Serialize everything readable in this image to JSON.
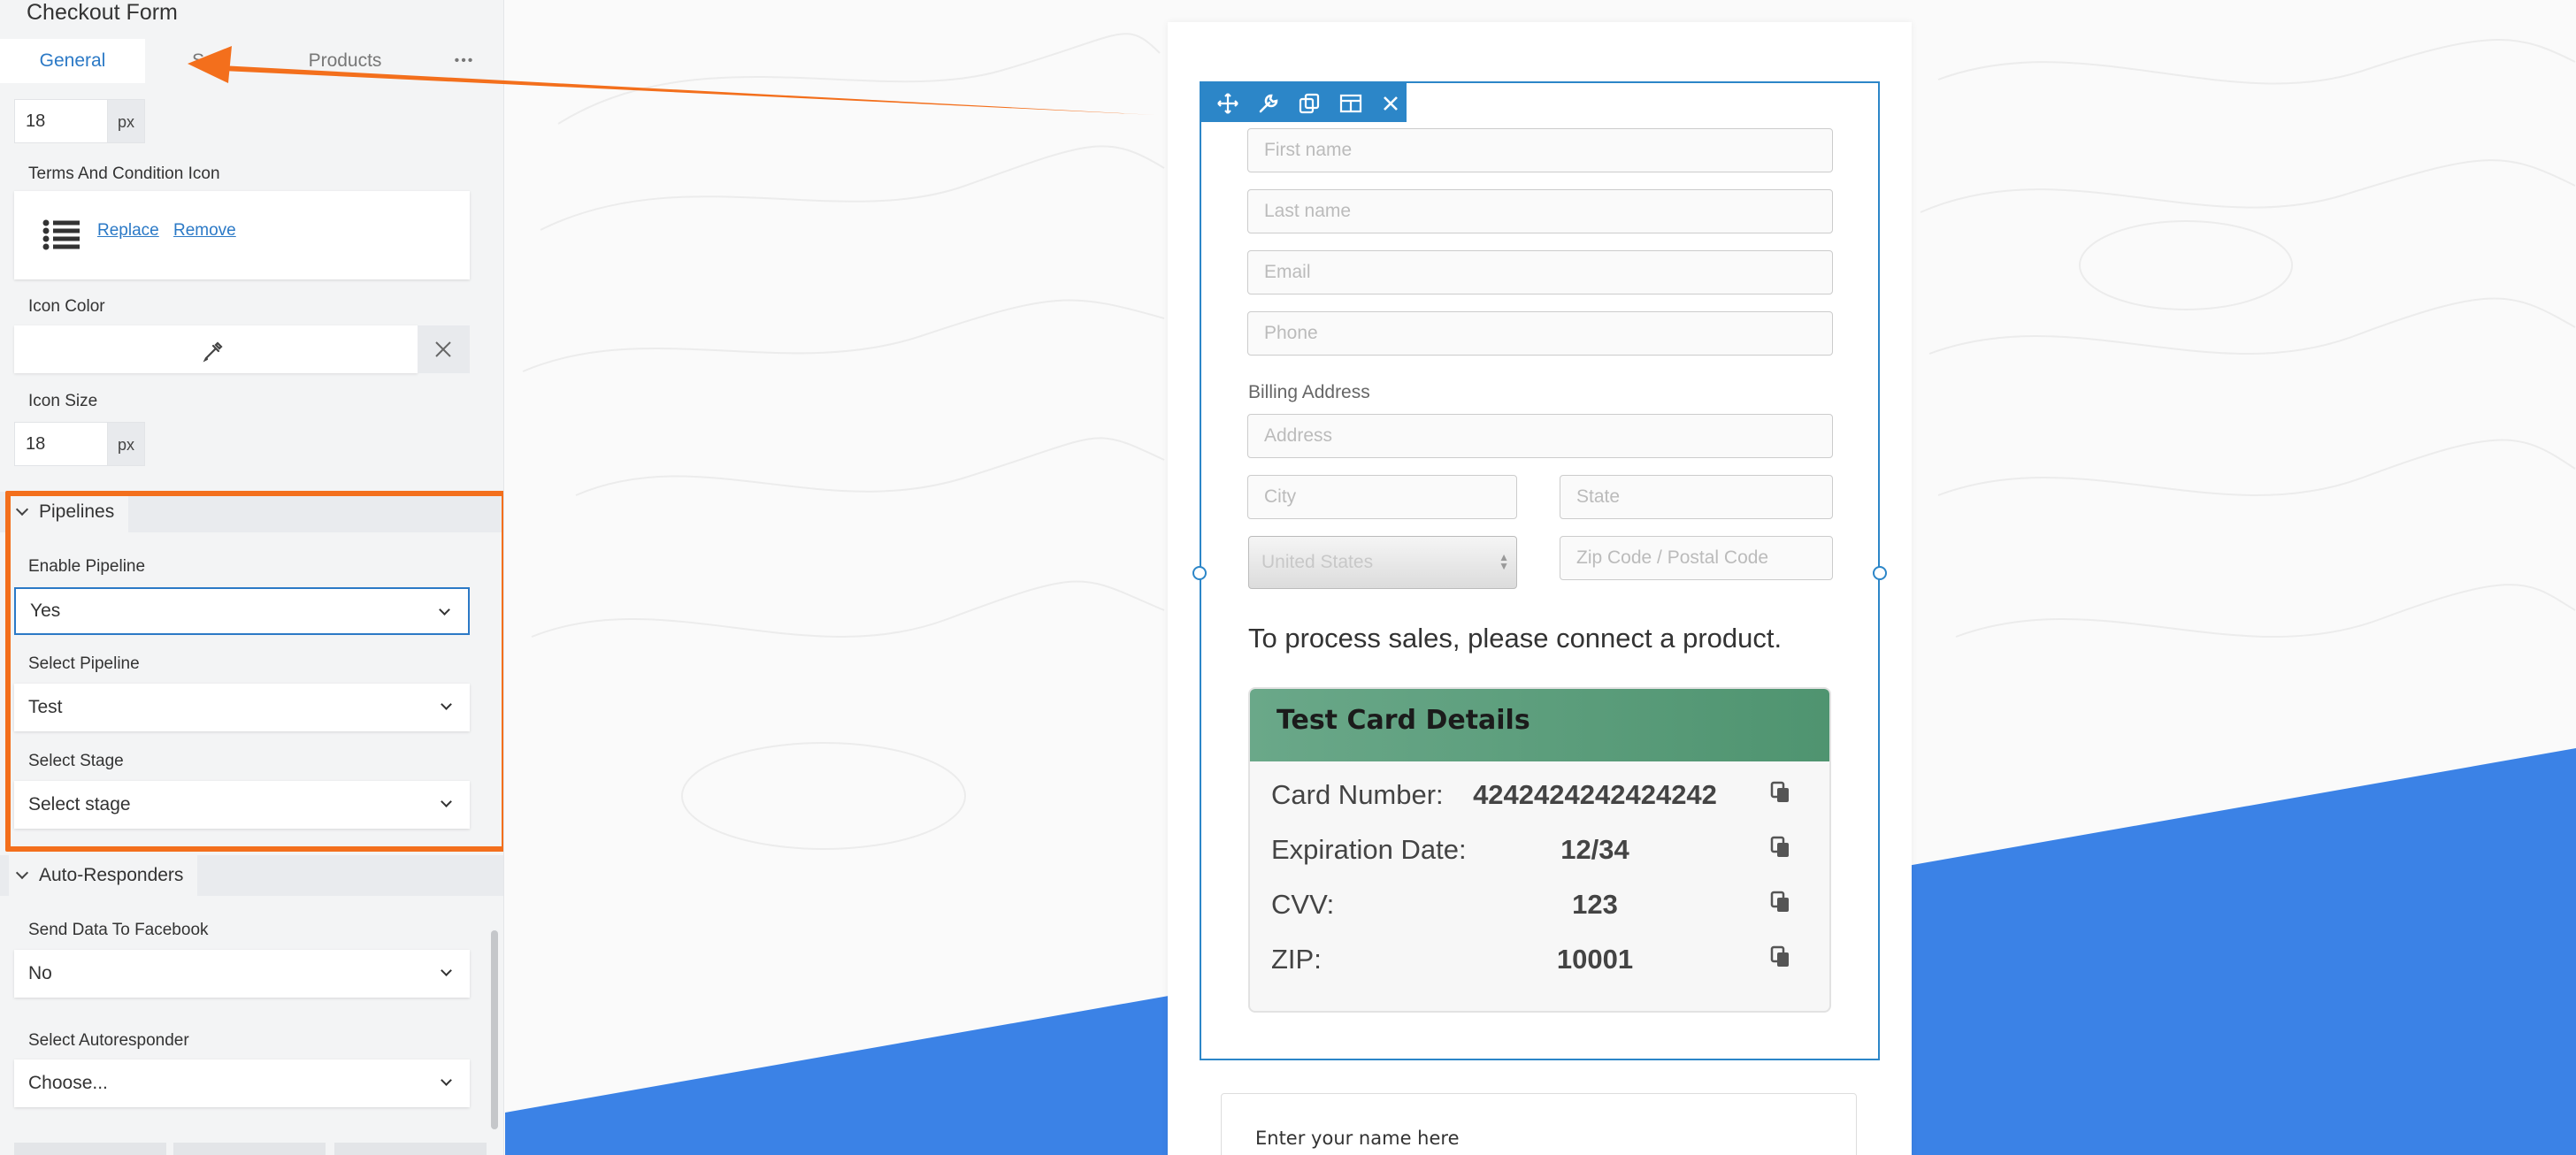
{
  "panel": {
    "title": "Checkout Form",
    "tabs": [
      {
        "label": "General"
      },
      {
        "label": "S"
      },
      {
        "label": "Products"
      }
    ],
    "more_label": "•••"
  },
  "settings": {
    "top_size_value": "18",
    "unit": "px",
    "terms_icon_label": "Terms And Condition Icon",
    "replace_label": "Replace",
    "remove_label": "Remove",
    "icon_color_label": "Icon Color",
    "icon_size_label": "Icon Size",
    "icon_size_value": "18"
  },
  "pipelines": {
    "section_label": "Pipelines",
    "enable_label": "Enable Pipeline",
    "enable_value": "Yes",
    "pipeline_label": "Select Pipeline",
    "pipeline_value": "Test",
    "stage_label": "Select Stage",
    "stage_value": "Select stage"
  },
  "autoresponders": {
    "section_label": "Auto-Responders",
    "facebook_label": "Send Data To Facebook",
    "facebook_value": "No",
    "autoresponder_label": "Select Autoresponder",
    "autoresponder_value": "Choose..."
  },
  "form": {
    "first_name_placeholder": "First name",
    "last_name_placeholder": "Last name",
    "email_placeholder": "Email",
    "phone_placeholder": "Phone",
    "billing_label": "Billing Address",
    "address_placeholder": "Address",
    "city_placeholder": "City",
    "state_placeholder": "State",
    "country_value": "United States",
    "zip_placeholder": "Zip Code / Postal Code",
    "connect_message": "To process sales, please connect a product.",
    "name_placeholder": "Enter your name here"
  },
  "test_card": {
    "title": "Test Card Details",
    "rows": [
      {
        "label": "Card Number:",
        "value": "4242424242424242"
      },
      {
        "label": "Expiration Date:",
        "value": "12/34"
      },
      {
        "label": "CVV:",
        "value": "123"
      },
      {
        "label": "ZIP:",
        "value": "10001"
      }
    ]
  },
  "colors": {
    "accent": "#2b79c6",
    "annotation": "#f36f1c",
    "card_header": "#5fa17e",
    "background_shape": "#3b82e6"
  }
}
